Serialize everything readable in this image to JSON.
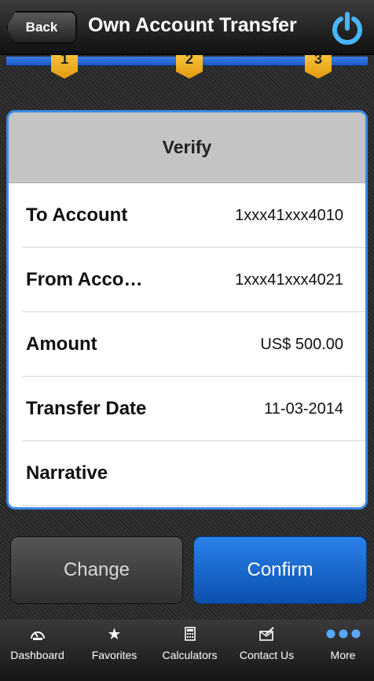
{
  "navbar": {
    "back_label": "Back",
    "title": "Own Account Transfer"
  },
  "steps": [
    "1",
    "2",
    "3"
  ],
  "card": {
    "title": "Verify",
    "rows": [
      {
        "label": "To Account",
        "value": "1xxx41xxx4010"
      },
      {
        "label": "From Acco…",
        "value": "1xxx41xxx4021"
      },
      {
        "label": "Amount",
        "value": "US$ 500.00"
      },
      {
        "label": "Transfer Date",
        "value": "11-03-2014"
      },
      {
        "label": "Narrative",
        "value": ""
      }
    ]
  },
  "actions": {
    "change_label": "Change",
    "confirm_label": "Confirm"
  },
  "tabbar": {
    "tabs": [
      {
        "label": "Dashboard",
        "icon": "speedometer-icon"
      },
      {
        "label": "Favorites",
        "icon": "star-icon"
      },
      {
        "label": "Calculators",
        "icon": "calculator-icon"
      },
      {
        "label": "Contact Us",
        "icon": "envelope-pencil-icon"
      },
      {
        "label": "More",
        "icon": "more-dots-icon"
      }
    ]
  },
  "colors": {
    "accent": "#2a82ea",
    "step": "#f4b823",
    "card_border": "#3d89e4"
  }
}
